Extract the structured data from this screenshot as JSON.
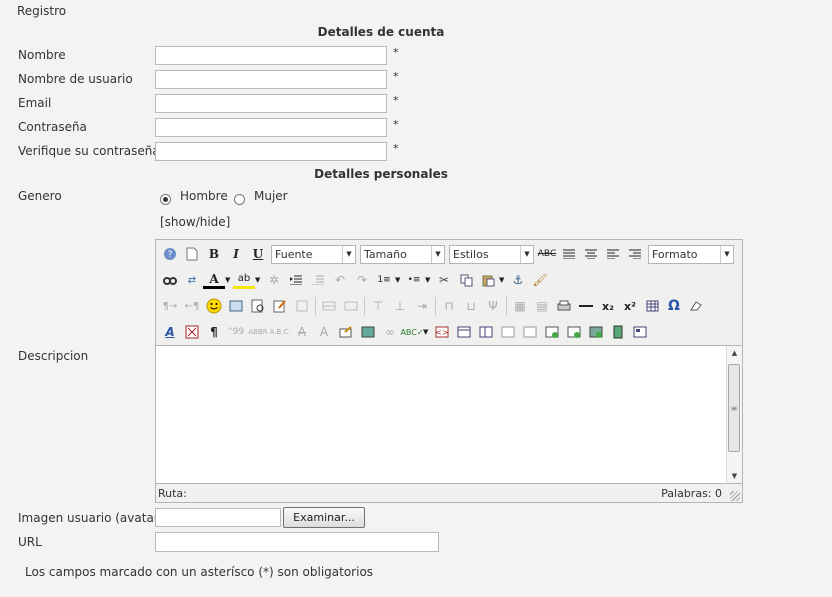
{
  "form": {
    "title": "Registro",
    "account_section": "Detalles de cuenta",
    "personal_section": "Detalles personales",
    "required_mark": "*",
    "fields": {
      "nombre": "Nombre",
      "usuario": "Nombre de usuario",
      "email": "Email",
      "password": "Contraseña",
      "verify": "Verifique su contraseña"
    },
    "genero_label": "Genero",
    "genero_options": [
      "Hombre",
      "Mujer"
    ],
    "genero_selected": "Hombre",
    "show_hide": "[show/hide]",
    "descripcion_label": "Descripcion",
    "avatar_label": "Imagen usuario (avatar)",
    "browse_button": "Examinar...",
    "url_label": "URL",
    "required_note": "Los campos marcado con un asterísco (*) son obligatorios"
  },
  "editor": {
    "selects": {
      "font": "Fuente",
      "size": "Tamaño",
      "styles": "Estilos",
      "format": "Formato"
    },
    "status_path": "Ruta:",
    "word_count": "Palabras: 0",
    "icons_row1": [
      "help-icon",
      "new-document-icon",
      "bold-icon",
      "italic-icon",
      "underline-icon",
      "strikethrough-icon",
      "justify-full-icon",
      "align-center-icon",
      "align-left-icon",
      "align-right-icon"
    ],
    "icons_row2": [
      "find-icon",
      "replace-icon",
      "font-color-icon",
      "highlight-color-icon",
      "cleanup-icon",
      "outdent-icon",
      "indent-icon",
      "undo-icon",
      "redo-icon",
      "ordered-list-icon",
      "unordered-list-icon",
      "cut-icon",
      "copy-icon",
      "paste-icon",
      "anchor-icon",
      "format-painter-icon"
    ],
    "icons_row3": [
      "ltr-icon",
      "rtl-icon",
      "emoticon-icon",
      "media-icon",
      "preview-icon",
      "edit-icon",
      "insert-date-icon",
      "table-row-icon",
      "table-cell-icon",
      "insert-row-icon",
      "delete-row-icon",
      "split-icon",
      "merge-icon",
      "col-before-icon",
      "col-after-icon",
      "delete-col-icon",
      "table-props-icon",
      "cell-props-icon",
      "print-icon",
      "horizontal-rule-icon",
      "subscript-icon",
      "superscript-icon",
      "table-icon",
      "special-char-icon",
      "remove-format-icon"
    ],
    "icons_row4": [
      "style-props-icon",
      "non-breaking-icon",
      "pilcrow-icon",
      "quote-icon",
      "abbr-icon",
      "acronym-icon",
      "del-icon",
      "ins-icon",
      "attribs-icon",
      "image-icon",
      "link-icon",
      "spellcheck-icon",
      "code-icon",
      "layer-icon",
      "template-icon",
      "page-break-icon",
      "iframe-icon",
      "readmore-icon",
      "form-icon",
      "add-module-icon",
      "gallery-icon",
      "film-icon",
      "fullscreen-icon"
    ]
  }
}
